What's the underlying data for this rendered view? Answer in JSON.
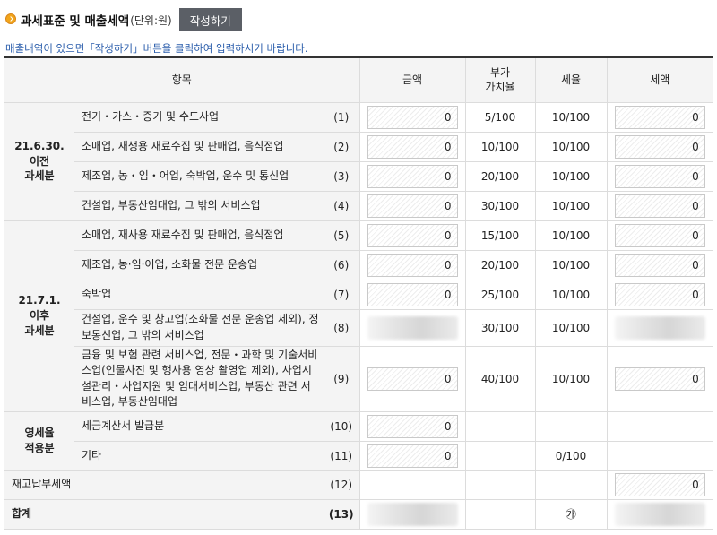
{
  "header": {
    "title": "과세표준 및 매출세액",
    "unit": "(단위:원)",
    "write_button": "작성하기"
  },
  "notice": "매출내역이 있으면「작성하기」버튼을 클릭하여 입력하시기 바랍니다.",
  "table": {
    "columns": {
      "item": "항목",
      "amount": "금액",
      "vat_rate_line1": "부가",
      "vat_rate_line2": "가치율",
      "tax_rate": "세율",
      "tax": "세액"
    },
    "groups": {
      "before": [
        "21.6.30.",
        "이전",
        "과세분"
      ],
      "after": [
        "21.7.1.",
        "이후",
        "과세분"
      ],
      "zero": [
        "영세율",
        "적용분"
      ]
    },
    "rows": [
      {
        "label": "전기・가스・증기 및 수도사업",
        "no": "(1)",
        "amount": "0",
        "vat_rate": "5/100",
        "tax_rate": "10/100",
        "tax": "0"
      },
      {
        "label": "소매업, 재생용 재료수집 및 판매업, 음식점업",
        "no": "(2)",
        "amount": "0",
        "vat_rate": "10/100",
        "tax_rate": "10/100",
        "tax": "0"
      },
      {
        "label": "제조업, 농・임・어업, 숙박업, 운수 및 통신업",
        "no": "(3)",
        "amount": "0",
        "vat_rate": "20/100",
        "tax_rate": "10/100",
        "tax": "0"
      },
      {
        "label": "건설업, 부동산임대업, 그 밖의 서비스업",
        "no": "(4)",
        "amount": "0",
        "vat_rate": "30/100",
        "tax_rate": "10/100",
        "tax": "0"
      },
      {
        "label": "소매업, 재사용 재료수집 및 판매업, 음식점업",
        "no": "(5)",
        "amount": "0",
        "vat_rate": "15/100",
        "tax_rate": "10/100",
        "tax": "0"
      },
      {
        "label": "제조업, 농·임·어업, 소화물 전문 운송업",
        "no": "(6)",
        "amount": "0",
        "vat_rate": "20/100",
        "tax_rate": "10/100",
        "tax": "0"
      },
      {
        "label": "숙박업",
        "no": "(7)",
        "amount": "0",
        "vat_rate": "25/100",
        "tax_rate": "10/100",
        "tax": "0"
      },
      {
        "label": "건설업, 운수 및 창고업(소화물 전문 운송업 제외), 정보통신업, 그 밖의 서비스업",
        "no": "(8)",
        "vat_rate": "30/100",
        "tax_rate": "10/100"
      },
      {
        "label": "금융 및 보험 관련 서비스업, 전문・과학 및 기술서비스업(인물사진 및 행사용 영상 촬영업 제외), 사업시설관리・사업지원 및 임대서비스업, 부동산 관련 서비스업, 부동산임대업",
        "no": "(9)",
        "amount": "0",
        "vat_rate": "40/100",
        "tax_rate": "10/100",
        "tax": "0"
      },
      {
        "label": "세금계산서 발급분",
        "no": "(10)",
        "amount": "0"
      },
      {
        "label": "기타",
        "no": "(11)",
        "amount": "0",
        "tax_rate": "0/100"
      },
      {
        "label": "재고납부세액",
        "no": "(12)",
        "tax": "0"
      },
      {
        "label": "합계",
        "no": "(13)",
        "tax_rate": "㉮"
      }
    ]
  }
}
